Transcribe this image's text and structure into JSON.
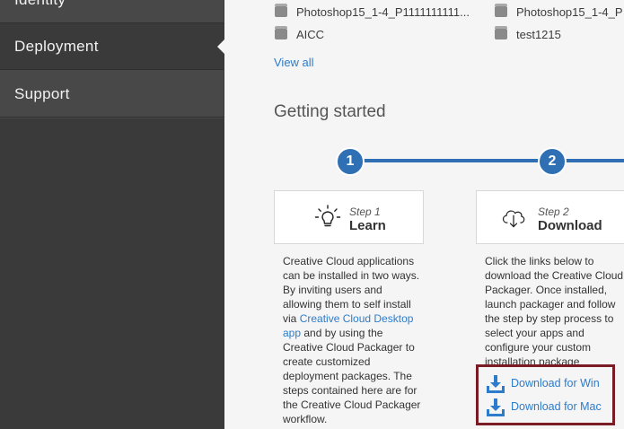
{
  "sidebar": {
    "items": [
      {
        "label": "Identity"
      },
      {
        "label": "Deployment",
        "active": true
      },
      {
        "label": "Support"
      }
    ]
  },
  "packages": [
    {
      "name": "Photoshop15_1-4_P1111111111..."
    },
    {
      "name": "Photoshop15_1-4_P"
    },
    {
      "name": "AICC"
    },
    {
      "name": "test1215"
    }
  ],
  "view_all": "View all",
  "getting_started": {
    "title": "Getting started",
    "steps": [
      {
        "number": "1",
        "label": "Step 1",
        "title": "Learn"
      },
      {
        "number": "2",
        "label": "Step 2",
        "title": "Download"
      }
    ],
    "step1_desc": {
      "lines": [
        "Creative Cloud applications",
        "can be installed in two ways.",
        "By inviting users and",
        "allowing them to self install",
        "via "
      ],
      "link1": "Creative Cloud Desktop",
      "link2": "app",
      "rest": [
        " and by using the",
        "Creative Cloud Packager to",
        "create customized",
        "deployment packages. The",
        "steps contained here are for",
        "the Creative Cloud Packager",
        "workflow."
      ]
    },
    "step2_desc": [
      "Click the links below to",
      "download the Creative Cloud",
      "Packager. Once installed,",
      "launch packager and follow",
      "the step by step process to",
      "select your apps and",
      "configure your custom",
      "installation package"
    ],
    "downloads": {
      "win": "Download for Win",
      "mac": "Download for Mac"
    }
  },
  "colors": {
    "sidebar": "#484848",
    "sidebar_active": "#3a3a3a",
    "accent_blue": "#2f6fb3",
    "link": "#2d7ccb",
    "highlight_border": "#7a1c24"
  }
}
